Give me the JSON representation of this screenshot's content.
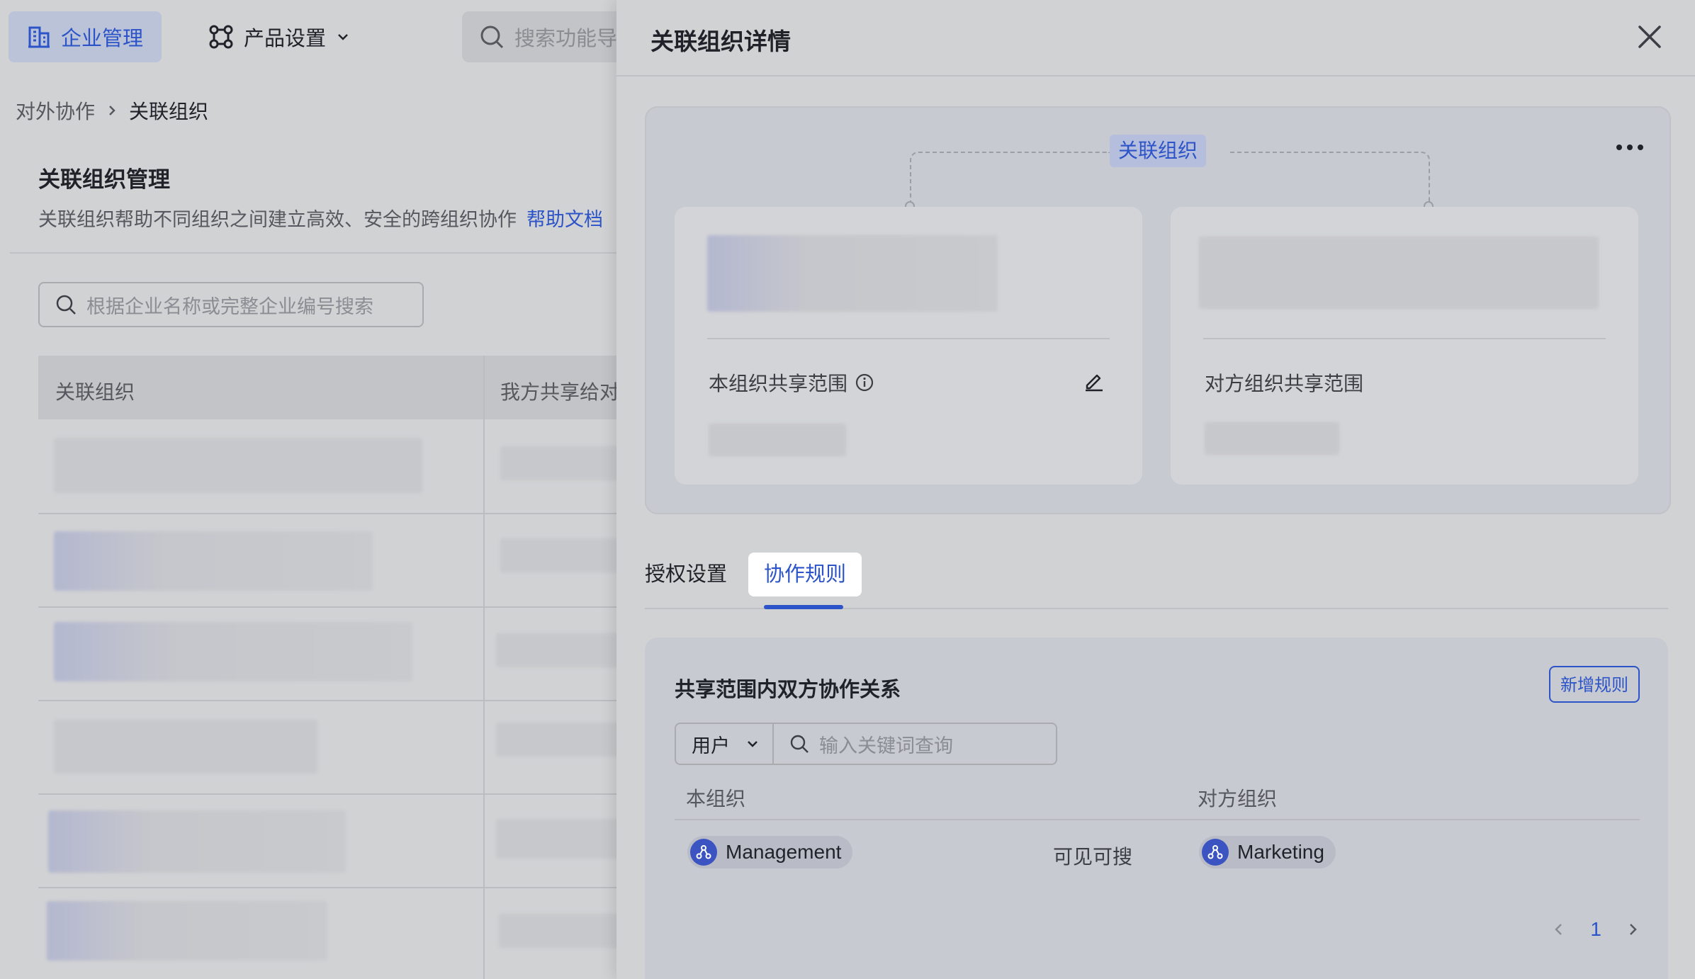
{
  "topnav": {
    "enterprise_label": "企业管理",
    "product_label": "产品设置",
    "search_placeholder": "搜索功能导"
  },
  "breadcrumb": {
    "parent": "对外协作",
    "current": "关联组织"
  },
  "background": {
    "title": "关联组织管理",
    "description": "关联组织帮助不同组织之间建立高效、安全的跨组织协作",
    "help_link": "帮助文档",
    "search_placeholder": "根据企业名称或完整企业编号搜索",
    "columns": [
      "关联组织",
      "我方共享给对"
    ]
  },
  "drawer": {
    "title": "关联组织详情",
    "relation_tag": "关联组织",
    "own_scope_label": "本组织共享范围",
    "other_scope_label": "对方组织共享范围",
    "tabs": [
      {
        "label": "授权设置",
        "active": false
      },
      {
        "label": "协作规则",
        "active": true
      }
    ],
    "rules": {
      "title": "共享范围内双方协作关系",
      "add_button": "新增规则",
      "filter_type": "用户",
      "filter_placeholder": "输入关键词查询",
      "columns": [
        "本组织",
        "对方组织"
      ],
      "rows": [
        {
          "own": "Management",
          "relation": "可见可搜",
          "other": "Marketing"
        }
      ],
      "page": "1"
    }
  },
  "colors": {
    "accent": "#2c54c8",
    "avatar": "#3b54c2"
  }
}
